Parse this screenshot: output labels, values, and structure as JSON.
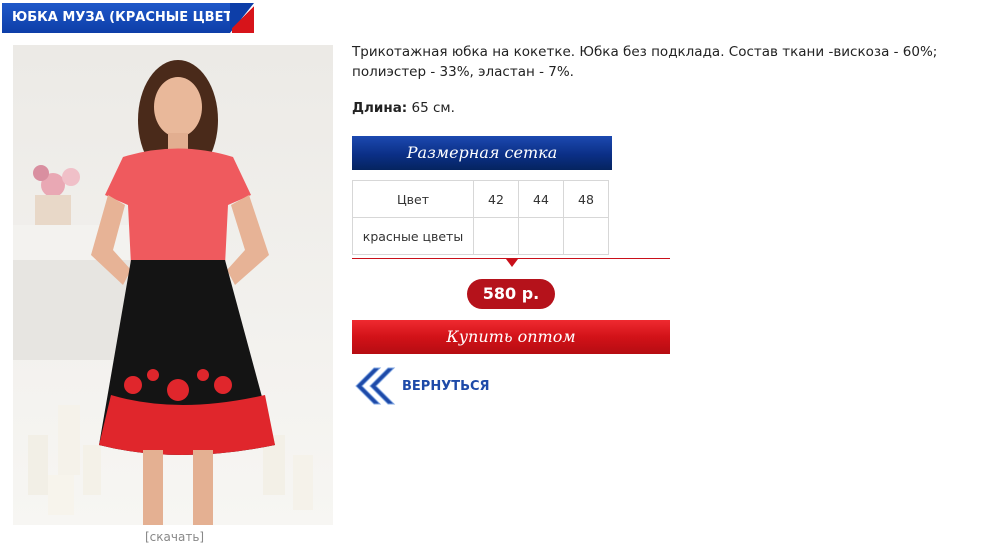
{
  "product": {
    "title": "ЮБКА МУЗА (КРАСНЫЕ ЦВЕТЫ)",
    "description": "Трикотажная юбка на кокетке. Юбка без подклада. Состав ткани -вискоза - 60%; полиэстер - 33%, эластан - 7%.",
    "length_label": "Длина:",
    "length_value": "65 см.",
    "enlarge_label": "[скачать]"
  },
  "size_grid": {
    "header": "Размерная сетка",
    "color_header": "Цвет",
    "sizes": [
      "42",
      "44",
      "48"
    ],
    "rows": [
      {
        "color": "красные цветы",
        "cells": [
          "",
          "",
          ""
        ]
      }
    ]
  },
  "price": "580 р.",
  "buy_button_label": "Купить оптом",
  "back_label": "ВЕРНУТЬСЯ",
  "colors": {
    "brand_blue": "#1f58c9",
    "accent_red": "#d21218",
    "price_red": "#b5121b"
  }
}
